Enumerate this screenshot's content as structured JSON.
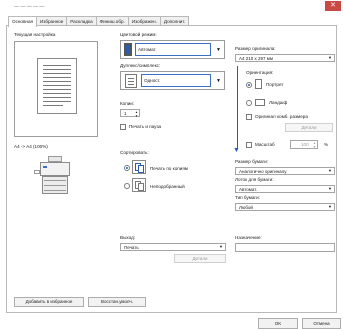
{
  "window": {
    "title": "— — — — —",
    "close_glyph": "✕"
  },
  "tabs": [
    {
      "label": "Основная"
    },
    {
      "label": "Избранное"
    },
    {
      "label": "Раскладка"
    },
    {
      "label": "Финиш.обр."
    },
    {
      "label": "Изображен."
    },
    {
      "label": "Дополнит."
    }
  ],
  "left": {
    "current_settings_label": "Текущая настройка",
    "page_info": "A4 -> A4 (100%)"
  },
  "middle": {
    "color_mode": {
      "label": "Цветовой режим:",
      "value": "Автомат."
    },
    "duplex": {
      "label": "Дуплекс/симплекс:",
      "value": "Одност."
    },
    "copies": {
      "label": "Копии:",
      "value": "1"
    },
    "print_pause": {
      "label": "Печать и пауза",
      "checked": false
    },
    "sort": {
      "label": "Сортировать:",
      "options": [
        {
          "label": "Печать по копиям",
          "selected": true
        },
        {
          "label": "Неподобранный",
          "selected": false
        }
      ]
    },
    "output": {
      "label": "Выход:",
      "value": "Печать",
      "details_label": "Детали"
    }
  },
  "right": {
    "original_size": {
      "label": "Размер оригинала:",
      "value": "A4 210 x 297 мм"
    },
    "orientation": {
      "label": "Ориентация:",
      "options": [
        {
          "label": "Портрет",
          "selected": true
        },
        {
          "label": "Ландшф",
          "selected": false
        }
      ]
    },
    "mixed_sizes": {
      "label": "Оригинал комб. размера",
      "checked": false,
      "details_label": "Детали"
    },
    "scale": {
      "label": "Масштаб",
      "value": "100",
      "unit": "%",
      "checked": false
    },
    "paper_size": {
      "label": "Размер бумаги:",
      "value": "Аналогично оригиналу"
    },
    "paper_tray": {
      "label": "Лоток для бумаги:",
      "value": "Автомат."
    },
    "paper_type": {
      "label": "Тип бумаги:",
      "value": "Любой"
    },
    "destination": {
      "label": "Назначение:",
      "value": ""
    }
  },
  "bottom": {
    "add_favorite_label": "Добавить в избранное",
    "restore_default_label": "Восстан.умолч.",
    "ok_label": "OK",
    "cancel_label": "Отмена"
  },
  "colors": {
    "accent": "#2a5db0",
    "close": "#c94a43"
  }
}
